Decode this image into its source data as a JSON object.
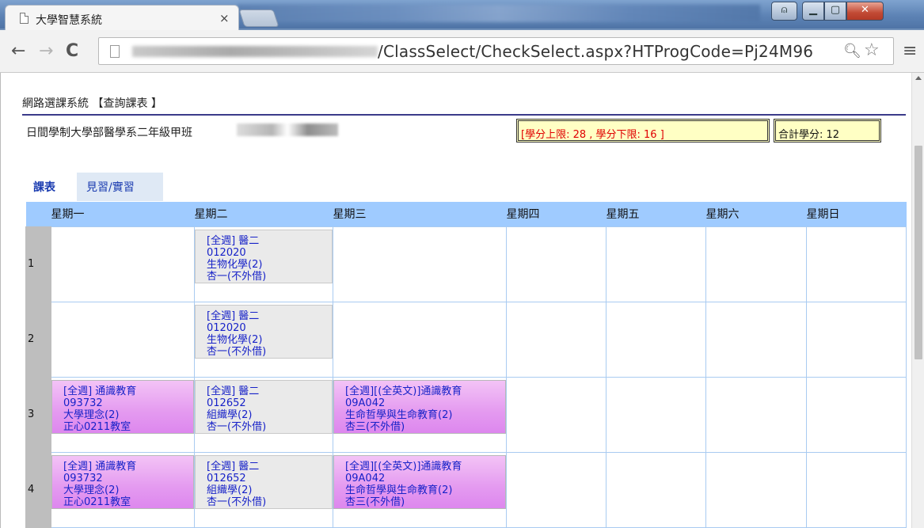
{
  "browser": {
    "tab_title": "大學智慧系統",
    "tab_close": "×",
    "url_path": "/ClassSelect/CheckSelect.aspx?HTProgCode=Pj24M96"
  },
  "page": {
    "system_title": "網路選課系統 【查詢課表 】",
    "class_name": "日間學制大學部醫學系二年級甲班",
    "credit_limit": "[學分上限: 28 , 學分下限: 16 ]",
    "credit_total": "合計學分: 12",
    "tabs": [
      "課表",
      "見習/實習"
    ]
  },
  "schedule": {
    "days": [
      "星期一",
      "星期二",
      "星期三",
      "星期四",
      "星期五",
      "星期六",
      "星期日"
    ],
    "periods": [
      {
        "label": "1",
        "cells": [
          null,
          {
            "style": "gray",
            "lines": [
              "[全週] 醫二",
              "012020",
              "生物化學(2)",
              "杏一(不外借)"
            ]
          },
          null,
          null,
          null,
          null,
          null
        ]
      },
      {
        "label": "2",
        "cells": [
          null,
          {
            "style": "gray",
            "lines": [
              "[全週] 醫二",
              "012020",
              "生物化學(2)",
              "杏一(不外借)"
            ]
          },
          null,
          null,
          null,
          null,
          null
        ]
      },
      {
        "label": "3",
        "cells": [
          {
            "style": "pink",
            "lines": [
              "[全週] 通識教育",
              "093732",
              "大學理念(2)",
              "正心0211教室"
            ]
          },
          {
            "style": "gray",
            "lines": [
              "[全週] 醫二",
              "012652",
              "組織學(2)",
              "杏一(不外借)"
            ]
          },
          {
            "style": "pink",
            "lines": [
              "[全週][(全英文)]通識教育",
              "09A042",
              "生命哲學與生命教育(2)",
              "杏三(不外借)"
            ]
          },
          null,
          null,
          null,
          null
        ]
      },
      {
        "label": "4",
        "cells": [
          {
            "style": "pink",
            "lines": [
              "[全週] 通識教育",
              "093732",
              "大學理念(2)",
              "正心0211教室"
            ]
          },
          {
            "style": "gray",
            "lines": [
              "[全週] 醫二",
              "012652",
              "組織學(2)",
              "杏一(不外借)"
            ]
          },
          {
            "style": "pink",
            "lines": [
              "[全週][(全英文)]通識教育",
              "09A042",
              "生命哲學與生命教育(2)",
              "杏三(不外借)"
            ]
          },
          null,
          null,
          null,
          null
        ]
      }
    ]
  },
  "icons": {
    "back": "back-arrow-icon",
    "forward": "forward-arrow-icon",
    "reload": "reload-icon",
    "zoom": "zoom-icon",
    "star": "bookmark-star-icon",
    "menu": "menu-icon"
  },
  "colors": {
    "header_row": "#9fcbff",
    "credit_box_bg": "#ffffc4",
    "credit_limit_text": "#e00000",
    "course_text": "#1722c8",
    "general_ed_cell": "#e49af0",
    "major_cell": "#eaeaea"
  }
}
